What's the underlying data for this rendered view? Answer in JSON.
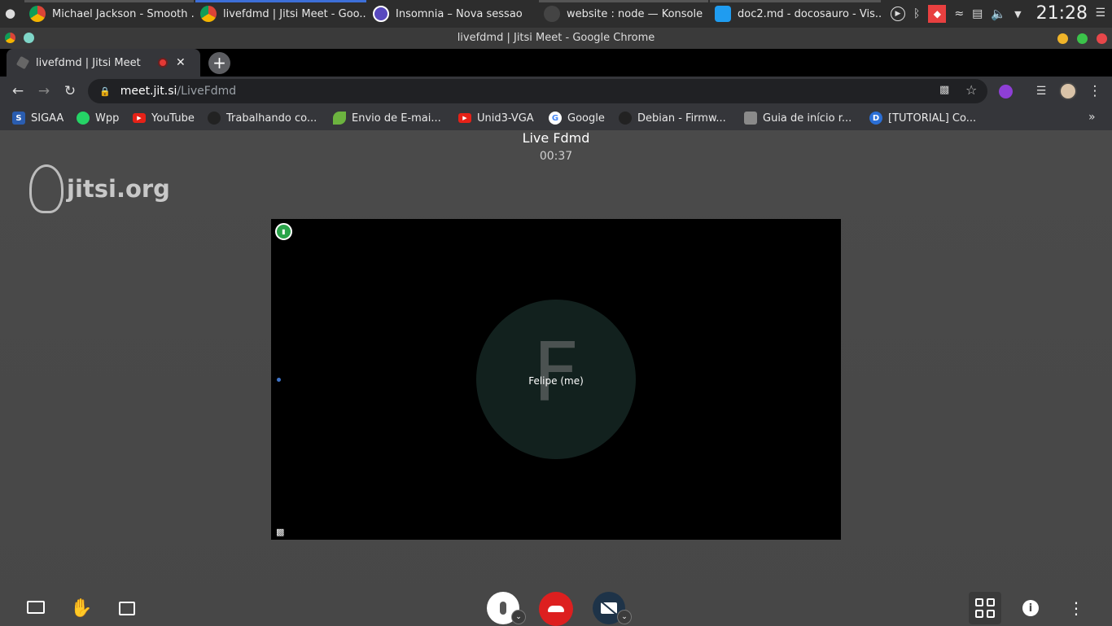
{
  "taskbar": {
    "tasks": [
      {
        "title": "Michael Jackson - Smooth ..."
      },
      {
        "title": "livefdmd | Jitsi Meet - Goo..."
      },
      {
        "title": "Insomnia – Nova sessao"
      },
      {
        "title": "website : node — Konsole"
      },
      {
        "title": "doc2.md - docosauro - Vis..."
      }
    ],
    "clock": "21:28"
  },
  "window": {
    "title": "livefdmd | Jitsi Meet - Google Chrome"
  },
  "tab": {
    "title": "livefdmd | Jitsi Meet"
  },
  "address": {
    "host": "meet.jit.si",
    "path": "/LiveFdmd"
  },
  "bookmarks": [
    {
      "label": "SIGAA"
    },
    {
      "label": "Wpp"
    },
    {
      "label": "YouTube"
    },
    {
      "label": "Trabalhando co..."
    },
    {
      "label": "Envio de E-mai..."
    },
    {
      "label": "Unid3-VGA"
    },
    {
      "label": "Google"
    },
    {
      "label": "Debian - Firmw..."
    },
    {
      "label": "Guia de início r..."
    },
    {
      "label": "[TUTORIAL] Co..."
    }
  ],
  "meeting": {
    "name": "Live Fdmd",
    "timer": "00:37",
    "logo": "jitsi.org",
    "participant": {
      "initial": "F",
      "name": "Felipe (me)"
    }
  },
  "colors": {
    "hangup": "#dd1f1f",
    "avatar_bg": "#12211e",
    "connection_ok": "#2aa34a"
  }
}
